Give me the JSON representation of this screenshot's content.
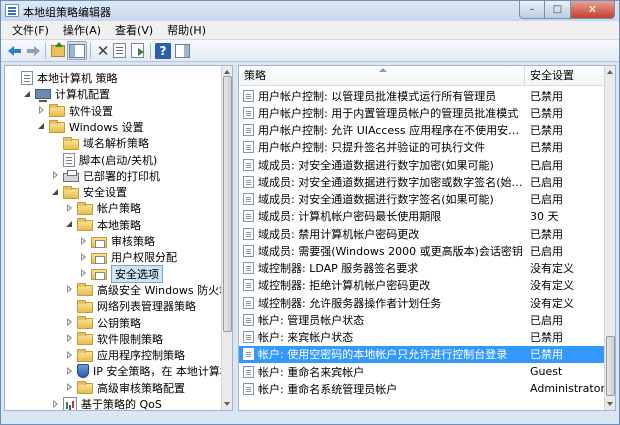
{
  "window": {
    "title": "本地组策略编辑器",
    "controls": {
      "minimize": "–",
      "maximize": "□",
      "close": "✕"
    }
  },
  "menubar": [
    {
      "label": "文件(F)"
    },
    {
      "label": "操作(A)"
    },
    {
      "label": "查看(V)"
    },
    {
      "label": "帮助(H)"
    }
  ],
  "toolbar": {
    "icons": [
      "back-icon",
      "forward-icon",
      "up-folder-icon",
      "show-tree-icon",
      "delete-icon",
      "properties-icon",
      "export-list-icon",
      "help-icon",
      "view-pane-icon"
    ],
    "help_glyph": "?",
    "delete_glyph": "✕"
  },
  "tree": [
    {
      "label": "本地计算机 策略",
      "level": 0,
      "icon": "doc",
      "toggle": "none"
    },
    {
      "label": "计算机配置",
      "level": 1,
      "icon": "computer",
      "toggle": "exp"
    },
    {
      "label": "软件设置",
      "level": 2,
      "icon": "folder",
      "toggle": "col"
    },
    {
      "label": "Windows 设置",
      "level": 2,
      "icon": "folder",
      "toggle": "exp"
    },
    {
      "label": "域名解析策略",
      "level": 3,
      "icon": "folder",
      "toggle": "none"
    },
    {
      "label": "脚本(启动/关机)",
      "level": 3,
      "icon": "doc",
      "toggle": "none"
    },
    {
      "label": "已部署的打印机",
      "level": 3,
      "icon": "printer",
      "toggle": "col"
    },
    {
      "label": "安全设置",
      "level": 3,
      "icon": "folder",
      "toggle": "exp"
    },
    {
      "label": "帐户策略",
      "level": 4,
      "icon": "folder",
      "toggle": "col"
    },
    {
      "label": "本地策略",
      "level": 4,
      "icon": "folder",
      "toggle": "exp"
    },
    {
      "label": "审核策略",
      "level": 5,
      "icon": "policy-folder",
      "toggle": "col"
    },
    {
      "label": "用户权限分配",
      "level": 5,
      "icon": "policy-folder",
      "toggle": "col"
    },
    {
      "label": "安全选项",
      "level": 5,
      "icon": "policy-folder",
      "toggle": "col",
      "selected": true
    },
    {
      "label": "高级安全 Windows 防火墙",
      "level": 4,
      "icon": "folder",
      "toggle": "col"
    },
    {
      "label": "网络列表管理器策略",
      "level": 4,
      "icon": "folder",
      "toggle": "none"
    },
    {
      "label": "公钥策略",
      "level": 4,
      "icon": "folder",
      "toggle": "col"
    },
    {
      "label": "软件限制策略",
      "level": 4,
      "icon": "folder",
      "toggle": "col"
    },
    {
      "label": "应用程序控制策略",
      "level": 4,
      "icon": "folder",
      "toggle": "col"
    },
    {
      "label": "IP 安全策略，在 本地计算机",
      "level": 4,
      "icon": "shieldnet",
      "toggle": "col"
    },
    {
      "label": "高级审核策略配置",
      "level": 4,
      "icon": "folder",
      "toggle": "col"
    },
    {
      "label": "基于策略的 QoS",
      "level": 3,
      "icon": "chart",
      "toggle": "col"
    }
  ],
  "list": {
    "columns": {
      "policy": "策略",
      "setting": "安全设置"
    },
    "rows": [
      {
        "policy": "用户帐户控制: 以管理员批准模式运行所有管理员",
        "setting": "已禁用"
      },
      {
        "policy": "用户帐户控制: 用于内置管理员帐户的管理员批准模式",
        "setting": "已禁用"
      },
      {
        "policy": "用户帐户控制: 允许 UIAccess 应用程序在不使用安全桌面...",
        "setting": "已禁用"
      },
      {
        "policy": "用户帐户控制: 只提升签名并验证的可执行文件",
        "setting": "已禁用"
      },
      {
        "policy": "域成员: 对安全通道数据进行数字加密(如果可能)",
        "setting": "已启用"
      },
      {
        "policy": "域成员: 对安全通道数据进行数字加密或数字签名(始终)",
        "setting": "已启用"
      },
      {
        "policy": "域成员: 对安全通道数据进行数字签名(如果可能)",
        "setting": "已启用"
      },
      {
        "policy": "域成员: 计算机帐户密码最长使用期限",
        "setting": "30 天"
      },
      {
        "policy": "域成员: 禁用计算机帐户密码更改",
        "setting": "已禁用"
      },
      {
        "policy": "域成员: 需要强(Windows 2000 或更高版本)会话密钥",
        "setting": "已启用"
      },
      {
        "policy": "域控制器: LDAP 服务器签名要求",
        "setting": "没有定义"
      },
      {
        "policy": "域控制器: 拒绝计算机帐户密码更改",
        "setting": "没有定义"
      },
      {
        "policy": "域控制器: 允许服务器操作者计划任务",
        "setting": "没有定义"
      },
      {
        "policy": "帐户: 管理员帐户状态",
        "setting": "已启用"
      },
      {
        "policy": "帐户: 来宾帐户状态",
        "setting": "已禁用"
      },
      {
        "policy": "帐户: 使用空密码的本地帐户只允许进行控制台登录",
        "setting": "已禁用",
        "selected": true
      },
      {
        "policy": "帐户: 重命名来宾帐户",
        "setting": "Guest"
      },
      {
        "policy": "帐户: 重命名系统管理员帐户",
        "setting": "Administrator"
      }
    ]
  }
}
